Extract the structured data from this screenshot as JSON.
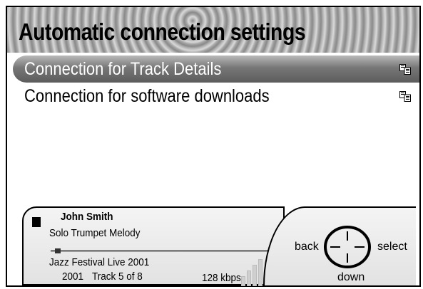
{
  "header": {
    "title": "Automatic connection settings"
  },
  "menu": {
    "items": [
      {
        "label": "Connection for Track Details",
        "selected": true,
        "icon": "connection-icon"
      },
      {
        "label": "Connection for software downloads",
        "selected": false,
        "icon": "connection-icon"
      }
    ]
  },
  "now_playing": {
    "artist": "John Smith",
    "track_title": "Solo Trumpet Melody",
    "album": "Jazz Festival Live 2001",
    "year": "2001",
    "track_position": "Track 5 of 8",
    "bitrate": "128 kbps",
    "progress": 0.02,
    "state_icon": "stop-icon"
  },
  "navigation": {
    "back_label": "back",
    "select_label": "select",
    "down_label": "down",
    "icon": "navigation-cross-icon"
  },
  "colors": {
    "selected_start": "#b9b9b9",
    "selected_end": "#5c5c5c",
    "panel_bg": "#eeeeee"
  }
}
